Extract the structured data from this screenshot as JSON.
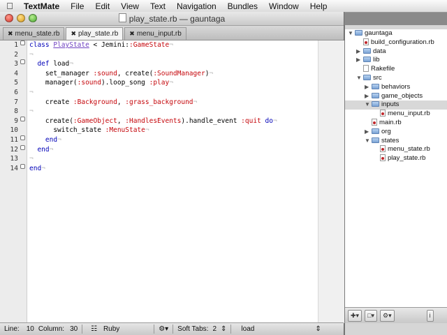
{
  "menubar": {
    "app": "TextMate",
    "items": [
      "File",
      "Edit",
      "View",
      "Text",
      "Navigation",
      "Bundles",
      "Window",
      "Help"
    ]
  },
  "window": {
    "title": "play_state.rb — gauntaga"
  },
  "tabs": [
    {
      "label": "menu_state.rb",
      "active": false
    },
    {
      "label": "play_state.rb",
      "active": true
    },
    {
      "label": "menu_input.rb",
      "active": false
    }
  ],
  "editor": {
    "line_numbers": [
      "1",
      "2",
      "3",
      "4",
      "5",
      "6",
      "7",
      "8",
      "9",
      "10",
      "11",
      "12",
      "13",
      "14"
    ],
    "lines": [
      "class PlayState < Jemini::GameState",
      "",
      "  def load",
      "    set_manager :sound, create(:SoundManager)",
      "    manager(:sound).loop_song :play",
      "",
      "    create :Background, :grass_background",
      "",
      "    create(:GameObject, :HandlesEvents).handle_event :quit do",
      "      switch_state :MenuState",
      "    end",
      "  end",
      "",
      "end"
    ]
  },
  "statusbar": {
    "line_label": "Line:",
    "line_value": "10",
    "column_label": "Column:",
    "column_value": "30",
    "language": "Ruby",
    "soft_tabs_label": "Soft Tabs:",
    "soft_tabs_value": "2",
    "symbol": "load"
  },
  "drawer": {
    "items": [
      {
        "label": "gauntaga",
        "type": "folder",
        "depth": 0,
        "open": true
      },
      {
        "label": "build_configuration.rb",
        "type": "rb",
        "depth": 1
      },
      {
        "label": "data",
        "type": "folder",
        "depth": 1,
        "open": false
      },
      {
        "label": "lib",
        "type": "folder",
        "depth": 1,
        "open": false
      },
      {
        "label": "Rakefile",
        "type": "file",
        "depth": 1
      },
      {
        "label": "src",
        "type": "folder",
        "depth": 1,
        "open": true
      },
      {
        "label": "behaviors",
        "type": "folder",
        "depth": 2,
        "open": false
      },
      {
        "label": "game_objects",
        "type": "folder",
        "depth": 2,
        "open": false
      },
      {
        "label": "inputs",
        "type": "folder",
        "depth": 2,
        "open": true,
        "selected": true
      },
      {
        "label": "menu_input.rb",
        "type": "rb",
        "depth": 3
      },
      {
        "label": "main.rb",
        "type": "rb",
        "depth": 2
      },
      {
        "label": "org",
        "type": "folder",
        "depth": 2,
        "open": false
      },
      {
        "label": "states",
        "type": "folder",
        "depth": 2,
        "open": true
      },
      {
        "label": "menu_state.rb",
        "type": "rb",
        "depth": 3
      },
      {
        "label": "play_state.rb",
        "type": "rb",
        "depth": 3
      }
    ]
  }
}
